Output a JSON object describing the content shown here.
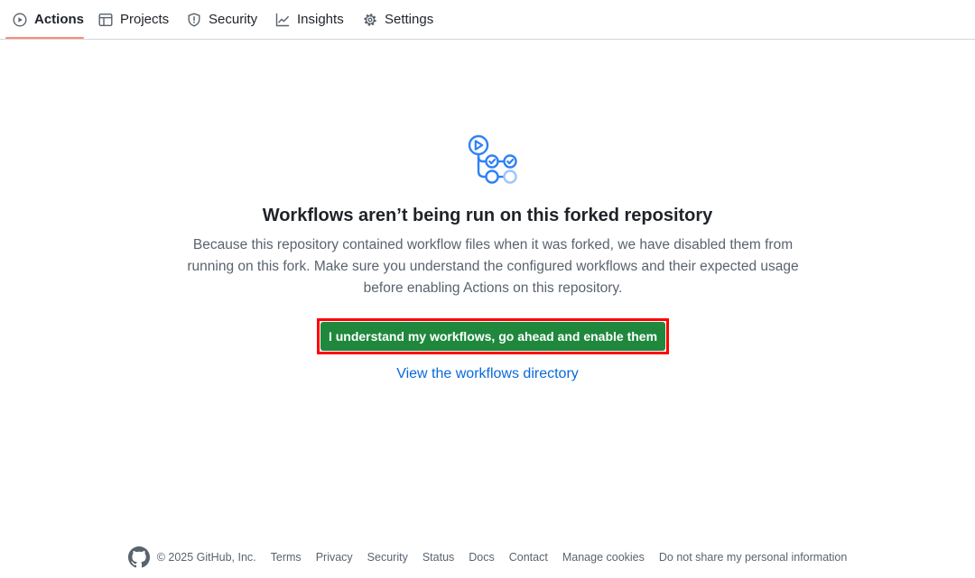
{
  "nav": {
    "tabs": [
      {
        "label": "Actions",
        "icon": "play-icon",
        "active": true
      },
      {
        "label": "Projects",
        "icon": "table-icon",
        "active": false
      },
      {
        "label": "Security",
        "icon": "shield-icon",
        "active": false
      },
      {
        "label": "Insights",
        "icon": "graph-icon",
        "active": false
      },
      {
        "label": "Settings",
        "icon": "gear-icon",
        "active": false
      }
    ],
    "active_underline_color": "#fd8c73"
  },
  "blankslate": {
    "icon": "workflow-icon",
    "title": "Workflows aren’t being run on this forked repository",
    "description": "Because this repository contained workflow files when it was forked, we have disabled them from running on this fork. Make sure you understand the configured workflows and their expected usage before enabling Actions on this repository.",
    "enable_button_label": "I understand my workflows, go ahead and enable them",
    "view_directory_link": "View the workflows directory",
    "button_color": "#1f883d",
    "highlight_color": "#ff0000",
    "link_color": "#0969da"
  },
  "footer": {
    "logo": "github-logo-icon",
    "copyright": "© 2025 GitHub, Inc.",
    "links": [
      "Terms",
      "Privacy",
      "Security",
      "Status",
      "Docs",
      "Contact",
      "Manage cookies",
      "Do not share my personal information"
    ]
  }
}
